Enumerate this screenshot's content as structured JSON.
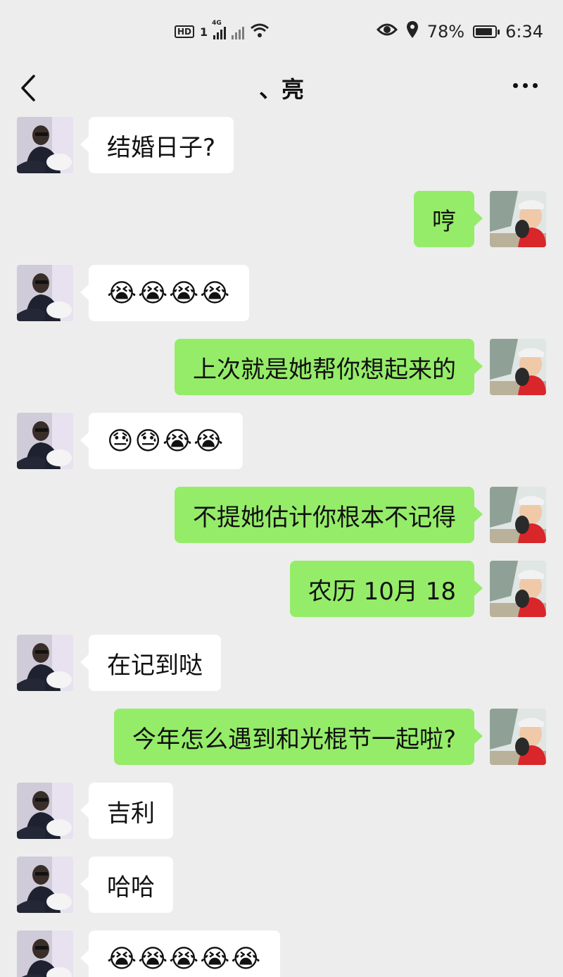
{
  "status_bar": {
    "hd": "HD",
    "sim": "1",
    "net": "4G",
    "battery": "78%",
    "time": "6:34"
  },
  "header": {
    "title": "、亮"
  },
  "messages": [
    {
      "from": "them",
      "text": "结婚日子?"
    },
    {
      "from": "me",
      "text": "哼"
    },
    {
      "from": "them",
      "text": "😭😭😭😭"
    },
    {
      "from": "me",
      "text": "上次就是她帮你想起来的"
    },
    {
      "from": "them",
      "text": "😓😓😭😭"
    },
    {
      "from": "me",
      "text": "不提她估计你根本不记得"
    },
    {
      "from": "me",
      "text": "农历 10月 18"
    },
    {
      "from": "them",
      "text": "在记到哒"
    },
    {
      "from": "me",
      "text": "今年怎么遇到和光棍节一起啦?"
    },
    {
      "from": "them",
      "text": "吉利"
    },
    {
      "from": "them",
      "text": "哈哈"
    },
    {
      "from": "them",
      "text": "😭😭😭😭😭"
    }
  ],
  "colors": {
    "background": "#ededed",
    "bubble_me": "#95ec69",
    "bubble_them": "#ffffff"
  }
}
